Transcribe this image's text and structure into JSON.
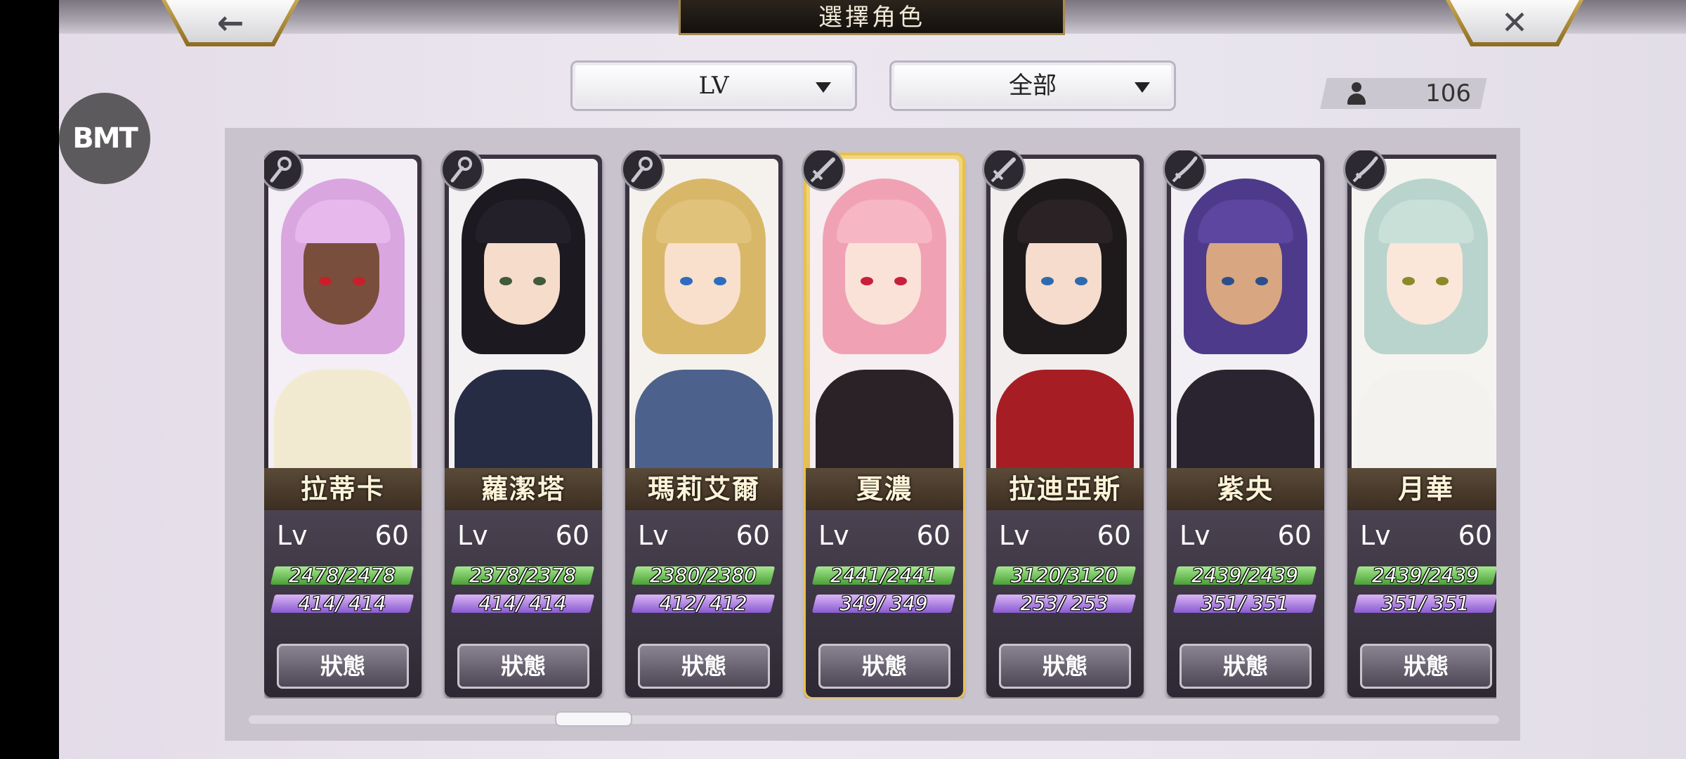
{
  "header": {
    "title": "選擇角色",
    "back_icon": "arrow-left-icon",
    "close_icon": "close-icon"
  },
  "filters": {
    "sort": {
      "value": "LV"
    },
    "category": {
      "value": "全部"
    }
  },
  "roster_count": "106",
  "logo_text": "BMT",
  "status_label": "狀態",
  "lv_label": "Lv",
  "cards": [
    {
      "name": "拉蒂卡",
      "lv": "60",
      "hp": "2478/2478",
      "mp": "414/ 414",
      "class_icon": "staff-icon",
      "selected": false
    },
    {
      "name": "蘿潔塔",
      "lv": "60",
      "hp": "2378/2378",
      "mp": "414/ 414",
      "class_icon": "staff-icon",
      "selected": false
    },
    {
      "name": "瑪莉艾爾",
      "lv": "60",
      "hp": "2380/2380",
      "mp": "412/ 412",
      "class_icon": "staff-icon",
      "selected": false
    },
    {
      "name": "夏濃",
      "lv": "60",
      "hp": "2441/2441",
      "mp": "349/ 349",
      "class_icon": "sword-icon",
      "selected": true
    },
    {
      "name": "拉迪亞斯",
      "lv": "60",
      "hp": "3120/3120",
      "mp": "253/ 253",
      "class_icon": "sword-icon",
      "selected": false
    },
    {
      "name": "紫央",
      "lv": "60",
      "hp": "2439/2439",
      "mp": "351/ 351",
      "class_icon": "katana-icon",
      "selected": false
    },
    {
      "name": "月華",
      "lv": "60",
      "hp": "2439/2439",
      "mp": "351/ 351",
      "class_icon": "katana-icon",
      "selected": false
    }
  ],
  "colors": {
    "accent_gold": "#e9c04d",
    "hp_green": "#4aa036",
    "mp_purple": "#8a5ad2"
  }
}
